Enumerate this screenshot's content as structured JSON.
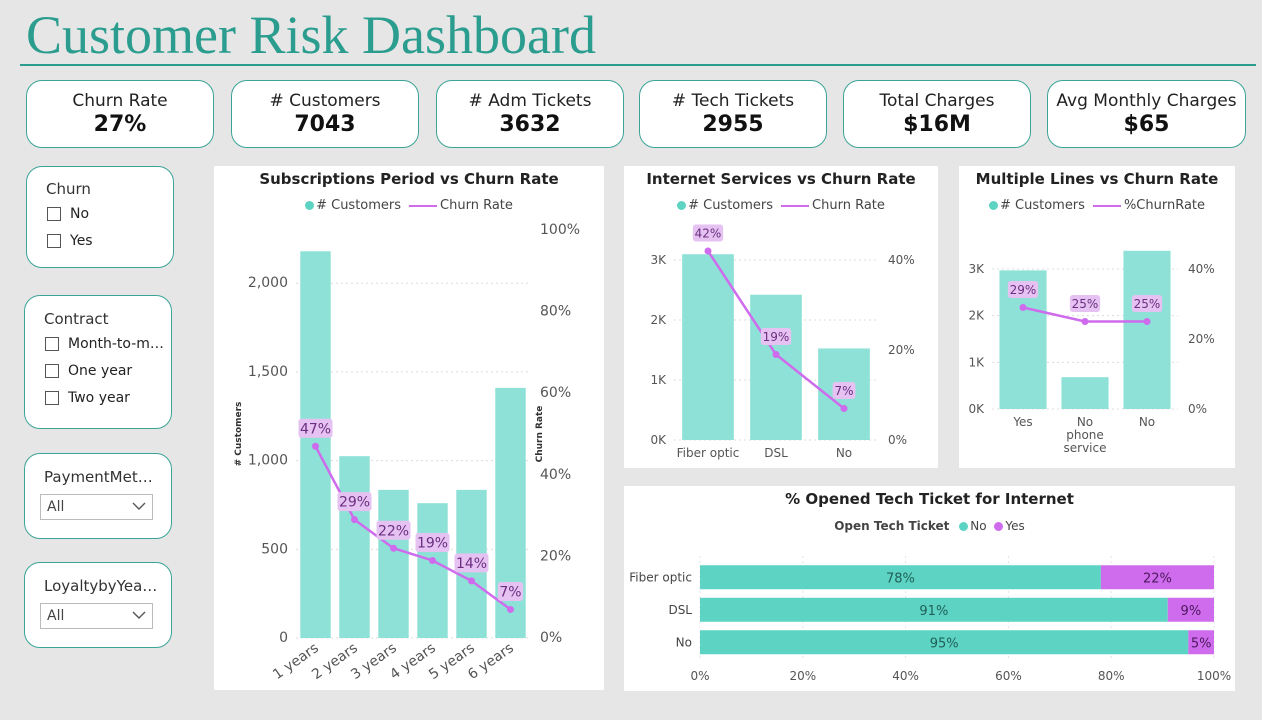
{
  "page_title": "Customer Risk Dashboard",
  "kpis": [
    {
      "label": "Churn Rate",
      "value": "27%"
    },
    {
      "label": "# Customers",
      "value": "7043"
    },
    {
      "label": "# Adm Tickets",
      "value": "3632"
    },
    {
      "label": "# Tech Tickets",
      "value": "2955"
    },
    {
      "label": "Total Charges",
      "value": "$16M"
    },
    {
      "label": "Avg Monthly Charges",
      "value": "$65"
    }
  ],
  "slicers": {
    "churn": {
      "title": "Churn",
      "options": [
        "No",
        "Yes"
      ]
    },
    "contract": {
      "title": "Contract",
      "options": [
        "Month-to-m…",
        "One year",
        "Two year"
      ]
    },
    "payment": {
      "title": "PaymentMet…",
      "selected": "All"
    },
    "loyalty": {
      "title": "LoyaltybyYea…",
      "selected": "All"
    }
  },
  "icons": {
    "checkbox": "checkbox-icon",
    "dropdown": "chevron-down-icon"
  },
  "colors": {
    "accent": "#2a9d8f",
    "bar": "#8ee1d6",
    "bar_strong": "#5dd3c4",
    "line": "#cf6bed",
    "label_bg": "#e6c2f2"
  },
  "chart_data": [
    {
      "type": "bar",
      "title": "Subscriptions Period vs Churn Rate",
      "legend": [
        "# Customers",
        "Churn Rate"
      ],
      "ylabel": "# Customers",
      "y2label": "Churn Rate",
      "categories": [
        "1 years",
        "2 years",
        "3 years",
        "4 years",
        "5 years",
        "6 years"
      ],
      "series": [
        {
          "name": "# Customers",
          "values": [
            2180,
            1025,
            835,
            760,
            835,
            1410
          ]
        },
        {
          "name": "Churn Rate",
          "values": [
            47,
            29,
            22,
            19,
            14,
            7
          ],
          "labels": [
            "47%",
            "29%",
            "22%",
            "19%",
            "14%",
            "7%"
          ]
        }
      ],
      "yticks": [
        "0",
        "500",
        "1,000",
        "1,500",
        "2,000"
      ],
      "y2ticks": [
        "0%",
        "20%",
        "40%",
        "60%",
        "80%",
        "100%"
      ],
      "ylim": [
        0,
        2300
      ],
      "y2lim": [
        0,
        100
      ]
    },
    {
      "type": "bar",
      "title": "Internet Services vs Churn Rate",
      "legend": [
        "# Customers",
        "Churn Rate"
      ],
      "categories": [
        "Fiber optic",
        "DSL",
        "No"
      ],
      "series": [
        {
          "name": "# Customers",
          "values": [
            3096,
            2421,
            1526
          ]
        },
        {
          "name": "Churn Rate",
          "values": [
            42,
            19,
            7
          ],
          "labels": [
            "42%",
            "19%",
            "7%"
          ]
        }
      ],
      "yticks": [
        "0K",
        "1K",
        "2K",
        "3K"
      ],
      "y2ticks": [
        "0%",
        "20%",
        "40%"
      ],
      "ylim": [
        0,
        3000
      ],
      "y2lim": [
        0,
        40
      ]
    },
    {
      "type": "bar",
      "title": "Multiple Lines vs Churn Rate",
      "legend": [
        "# Customers",
        "%ChurnRate"
      ],
      "categories": [
        "Yes",
        "No phone service",
        "No"
      ],
      "category_lines": [
        [
          "Yes"
        ],
        [
          "No",
          "phone",
          "service"
        ],
        [
          "No"
        ]
      ],
      "series": [
        {
          "name": "# Customers",
          "values": [
            2971,
            682,
            3390
          ]
        },
        {
          "name": "%ChurnRate",
          "values": [
            29,
            25,
            25
          ],
          "labels": [
            "29%",
            "25%",
            "25%"
          ]
        }
      ],
      "yticks": [
        "0K",
        "1K",
        "2K",
        "3K"
      ],
      "y2ticks": [
        "0%",
        "20%",
        "40%"
      ],
      "ylim": [
        0,
        3000
      ],
      "y2lim": [
        0,
        40
      ]
    },
    {
      "type": "bar",
      "title": "% Opened Tech Ticket for Internet",
      "legend_title": "Open Tech Ticket",
      "legend": [
        "No",
        "Yes"
      ],
      "categories": [
        "Fiber optic",
        "DSL",
        "No"
      ],
      "series": [
        {
          "name": "No",
          "values": [
            78,
            91,
            95
          ],
          "labels": [
            "78%",
            "91%",
            "95%"
          ]
        },
        {
          "name": "Yes",
          "values": [
            22,
            9,
            5
          ],
          "labels": [
            "22%",
            "9%",
            "5%"
          ]
        }
      ],
      "xticks": [
        "0%",
        "20%",
        "40%",
        "60%",
        "80%",
        "100%"
      ],
      "xlim": [
        0,
        100
      ]
    }
  ]
}
